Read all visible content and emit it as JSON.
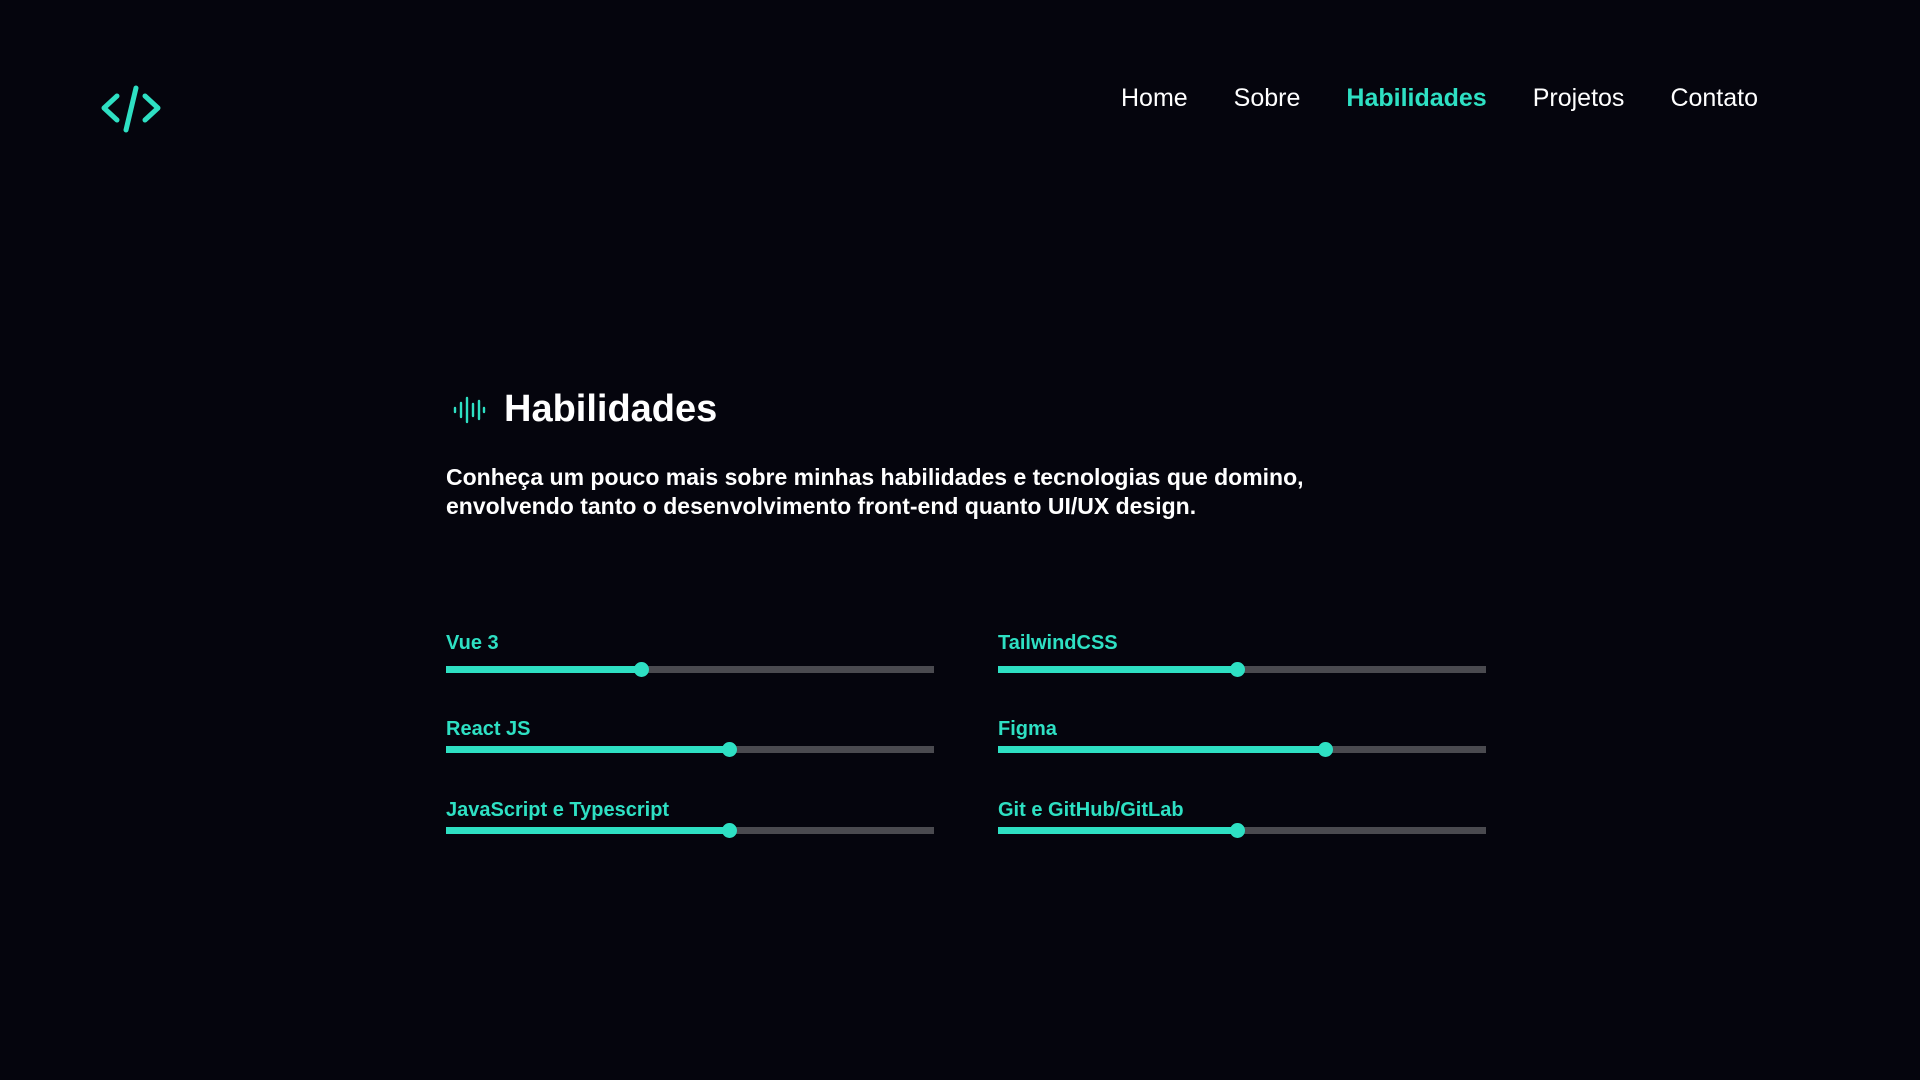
{
  "header": {
    "logo_icon": "code-brackets-icon",
    "nav": [
      {
        "label": "Home",
        "active": false
      },
      {
        "label": "Sobre",
        "active": false
      },
      {
        "label": "Habilidades",
        "active": true
      },
      {
        "label": "Projetos",
        "active": false
      },
      {
        "label": "Contato",
        "active": false
      }
    ]
  },
  "section": {
    "icon": "sound-wave-icon",
    "title": "Habilidades",
    "description_line1": "Conheça um pouco mais sobre minhas habilidades e tecnologias que domino,",
    "description_line2": "envolvendo tanto o desenvolvimento front-end quanto UI/UX design."
  },
  "skills": [
    {
      "label": "Vue 3",
      "level": 0.4
    },
    {
      "label": "TailwindCSS",
      "level": 0.49
    },
    {
      "label": "React JS",
      "level": 0.58
    },
    {
      "label": "Figma",
      "level": 0.67
    },
    {
      "label": "JavaScript e Typescript",
      "level": 0.58
    },
    {
      "label": "Git e GitHub/GitLab",
      "level": 0.49
    }
  ],
  "colors": {
    "background": "#05050d",
    "accent": "#2ee0c3",
    "track": "#4a4a4f",
    "text": "#ffffff"
  }
}
